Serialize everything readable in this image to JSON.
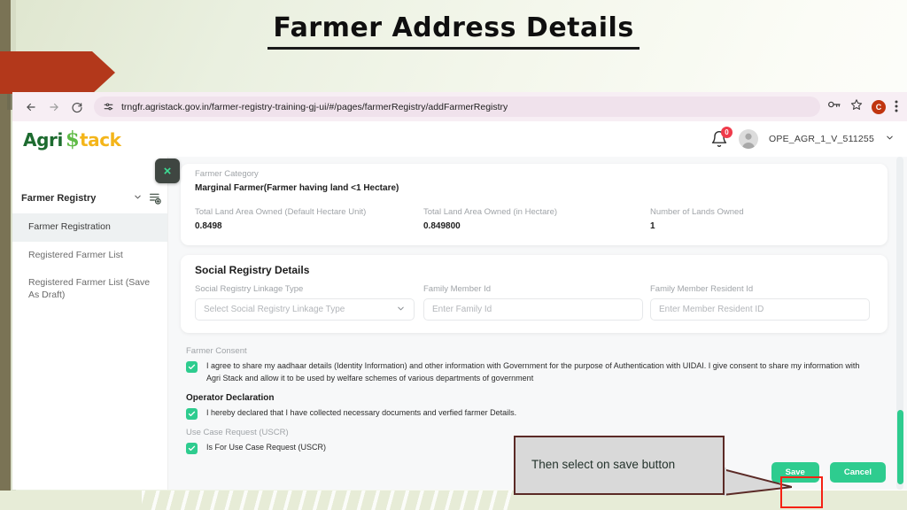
{
  "slide": {
    "title": "Farmer Address Details"
  },
  "browser": {
    "back_icon": "arrow-left-icon",
    "forward_icon": "arrow-right-icon",
    "reload_icon": "reload-icon",
    "site_settings_icon": "tune-icon",
    "url": "trngfr.agristack.gov.in/farmer-registry-training-gj-ui/#/pages/farmerRegistry/addFarmerRegistry",
    "passwords_icon": "key-icon",
    "bookmark_icon": "star-icon",
    "profile_initial": "C",
    "menu_icon": "kebab-menu-icon"
  },
  "app_header": {
    "logo_part1": "Agri",
    "logo_s": "$",
    "logo_part2": "tack",
    "notification_icon": "bell-icon",
    "notification_count": "0",
    "avatar_icon": "user-avatar-icon",
    "user_name": "OPE_AGR_1_V_511255",
    "user_caret": "chevron-down-icon"
  },
  "sidebar": {
    "close_label": "×",
    "group_title": "Farmer Registry",
    "group_caret": "chevron-down-icon",
    "add_doc_icon": "document-add-icon",
    "items": [
      {
        "label": "Farmer Registration",
        "active": true
      },
      {
        "label": "Registered Farmer List",
        "active": false
      },
      {
        "label": "Registered Farmer List (Save As Draft)",
        "active": false
      }
    ]
  },
  "farmer_category_card": {
    "category_label": "Farmer Category",
    "category_value": "Marginal  Farmer(Farmer having land <1 Hectare)",
    "fields": [
      {
        "label": "Total Land Area Owned (Default Hectare Unit)",
        "value": "0.8498"
      },
      {
        "label": "Total Land Area Owned (in Hectare)",
        "value": "0.849800"
      },
      {
        "label": "Number of Lands Owned",
        "value": "1"
      }
    ]
  },
  "social_registry_card": {
    "title": "Social Registry Details",
    "linkage_type_label": "Social Registry Linkage Type",
    "linkage_type_placeholder": "Select Social Registry Linkage Type",
    "linkage_type_caret": "chevron-down-icon",
    "family_member_id_label": "Family Member Id",
    "family_member_id_placeholder": "Enter Family Id",
    "family_member_resident_id_label": "Family Member Resident Id",
    "family_member_resident_id_placeholder": "Enter Member Resident ID"
  },
  "consent": {
    "farmer_consent_label": "Farmer Consent",
    "farmer_consent_text": "I agree to share my aadhaar details (Identity Information) and other information with Government for the purpose of Authentication with UIDAI. I give consent to share my information with Agri Stack and allow it to be used by welfare schemes of various departments of government",
    "operator_declaration_label": "Operator Declaration",
    "operator_declaration_text": "I hereby declared that I have collected necessary documents and verfied farmer Details.",
    "uscr_label": "Use Case Request (USCR)",
    "uscr_text": "Is For Use Case Request (USCR)"
  },
  "footer": {
    "save_label": "Save",
    "cancel_label": "Cancel"
  },
  "annotation": {
    "callout_text": "Then select on save button"
  },
  "colors": {
    "accent_green": "#2ecc8f",
    "logo_green": "#1d6b2f",
    "logo_yellow": "#f4b51a",
    "badge_red": "#ef3b4b",
    "highlight_red": "#f52114",
    "callout_border": "#5b2a26",
    "banner_rust": "#b3381b"
  }
}
